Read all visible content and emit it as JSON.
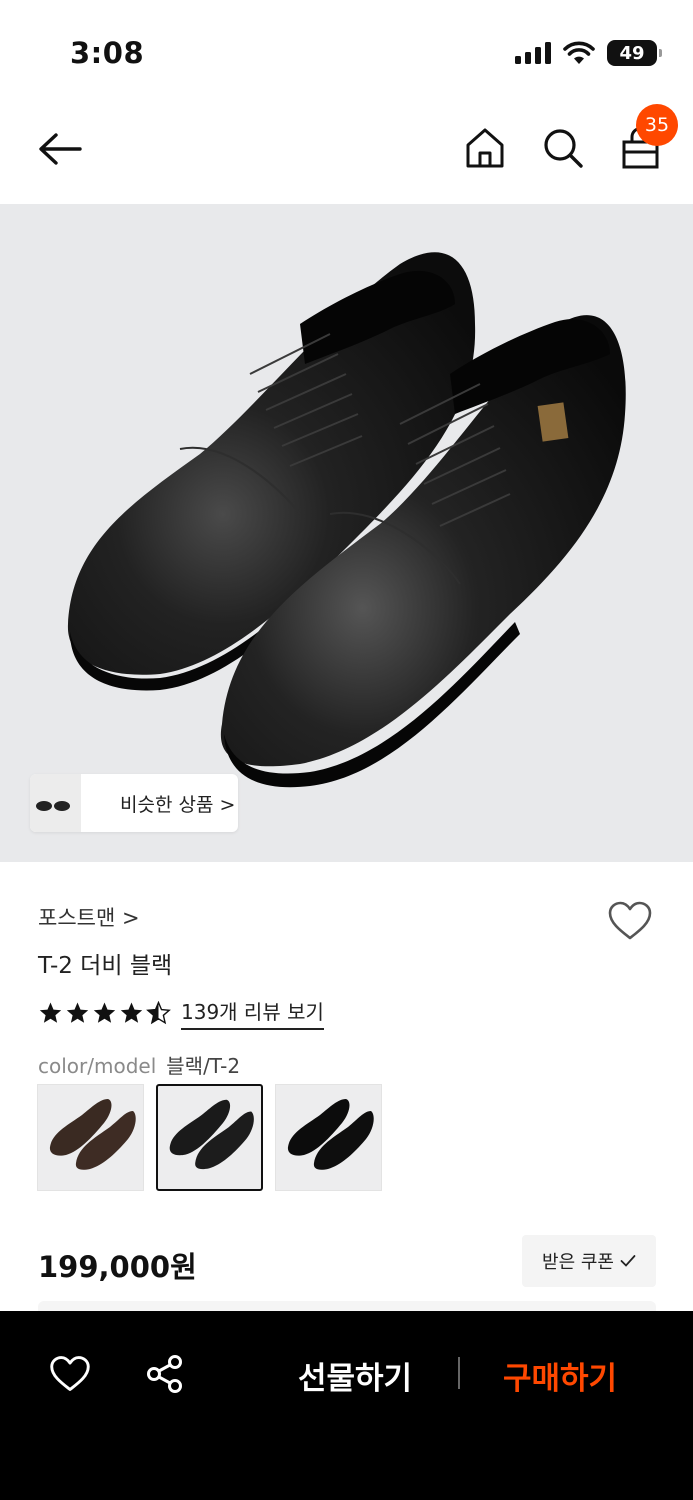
{
  "status_bar": {
    "time": "3:08",
    "battery": "49"
  },
  "nav": {
    "cart_count": "35"
  },
  "hero": {
    "similar_label": "비슷한 상품 >"
  },
  "product": {
    "brand": "포스트맨 >",
    "name": "T-2 더비 블랙",
    "rating": 4.5,
    "review_link": "139개 리뷰 보기",
    "option_key": "color/model",
    "option_value": "블랙/T-2",
    "swatches": [
      {
        "color": "brown",
        "selected": false
      },
      {
        "color": "black",
        "selected": true
      },
      {
        "color": "black-glossy",
        "selected": false
      }
    ],
    "price": "199,000원",
    "coupon_label": "받은 쿠폰"
  },
  "bottom_bar": {
    "gift_label": "선물하기",
    "buy_label": "구매하기"
  },
  "colors": {
    "accent": "#ff4800",
    "bottom_bar_bg": "#000000",
    "hero_bg": "#e8e9eb"
  }
}
